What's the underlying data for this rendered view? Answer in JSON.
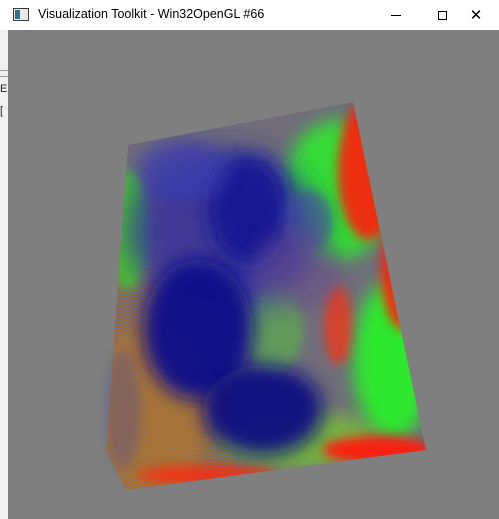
{
  "window": {
    "title": "Visualization Toolkit - Win32OpenGL #66",
    "icon": "vtk-window-icon",
    "controls": {
      "minimize_icon": "minimize-icon",
      "maximize_icon": "maximize-icon",
      "close_icon": "close-icon",
      "close_glyph": "✕"
    }
  },
  "backdrop": {
    "glyph_b": "E",
    "glyph_c": "["
  },
  "render": {
    "background_color": "#7f7f7f",
    "colors": {
      "blue": "#1a1a9e",
      "deep_blue": "#0a0a78",
      "green": "#2cf02c",
      "red": "#ff1a10",
      "orange": "#b8741a",
      "purple": "#6a4a8a"
    }
  }
}
